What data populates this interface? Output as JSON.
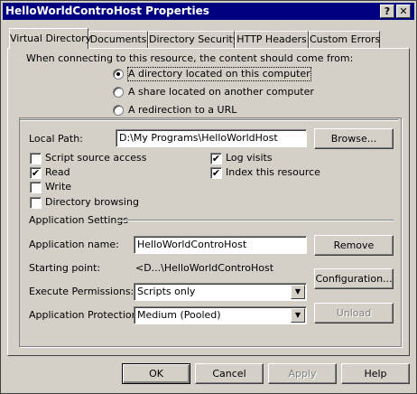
{
  "window": {
    "title": "HelloWorldControHost Properties",
    "help_label": "?",
    "close_label": "✕"
  },
  "tabs": [
    {
      "label": "Virtual Directory",
      "active": true
    },
    {
      "label": "Documents"
    },
    {
      "label": "Directory Security"
    },
    {
      "label": "HTTP Headers"
    },
    {
      "label": "Custom Errors"
    }
  ],
  "content_source": {
    "prompt": "When connecting to this resource, the content should come from:",
    "options": [
      "A directory located on this computer",
      "A share located on another computer",
      "A redirection to a URL"
    ],
    "selected": 0
  },
  "local_path": {
    "label": "Local Path:",
    "value": "D:\\My Programs\\HelloWorldHost",
    "browse_label": "Browse..."
  },
  "checkboxes": {
    "script_source_access": {
      "label": "Script source access",
      "checked": false
    },
    "read": {
      "label": "Read",
      "checked": true
    },
    "write": {
      "label": "Write",
      "checked": false
    },
    "directory_browsing": {
      "label": "Directory browsing",
      "checked": false
    },
    "log_visits": {
      "label": "Log visits",
      "checked": true
    },
    "index_resource": {
      "label": "Index this resource",
      "checked": true
    }
  },
  "app_settings": {
    "header": "Application Settings",
    "name_label": "Application name:",
    "name_value": "HelloWorldControHost",
    "remove_label": "Remove",
    "starting_point_label": "Starting point:",
    "starting_point_value": "<D...\\HelloWorldControHost",
    "configuration_label": "Configuration...",
    "execute_label": "Execute Permissions:",
    "execute_value": "Scripts only",
    "protection_label": "Application Protection:",
    "protection_value": "Medium (Pooled)",
    "unload_label": "Unload"
  },
  "footer": {
    "ok": "OK",
    "cancel": "Cancel",
    "apply": "Apply",
    "help": "Help"
  },
  "check_glyph": "✔",
  "dropdown_glyph": "▼"
}
